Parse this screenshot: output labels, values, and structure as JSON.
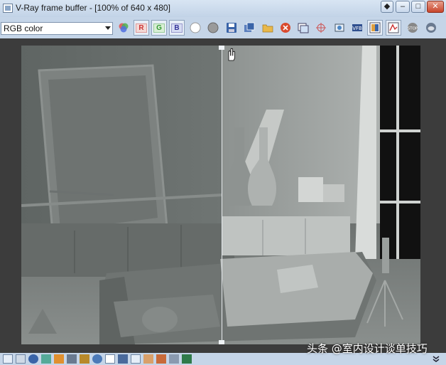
{
  "window": {
    "title": "V-Ray frame buffer - [100% of 640 x 480]",
    "buttons": [
      "◆",
      "–",
      "□",
      "✕"
    ]
  },
  "toolbar": {
    "channel_select": "RGB color",
    "channel_buttons": [
      "R",
      "G",
      "B"
    ]
  },
  "watermark": "头条 @室内设计谈单技巧",
  "colors": {
    "title_bar": "#c2d3e7",
    "frame_bg": "#3c3c3c",
    "accent_red": "#d94a2e"
  }
}
